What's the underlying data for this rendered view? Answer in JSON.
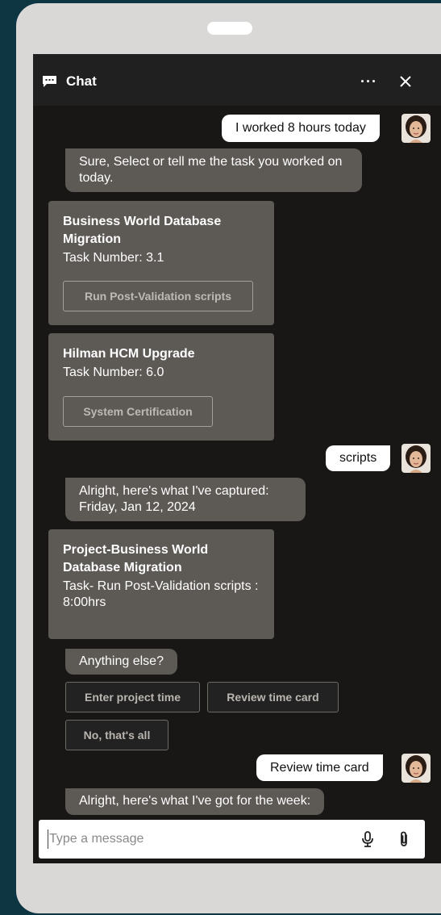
{
  "header": {
    "title": "Chat",
    "chat_icon": "chat-bubble-icon",
    "more_icon": "more-horizontal-icon",
    "close_icon": "close-icon",
    "more_glyph": "···"
  },
  "messages": {
    "m1": "I worked 8 hours today",
    "m2": "Sure, Select or tell me the task you worked on today.",
    "card1": {
      "title": "Business World Database Migration",
      "subtitle": "Task Number: 3.1",
      "action": "Run Post-Validation scripts"
    },
    "card2": {
      "title": "Hilman HCM Upgrade",
      "subtitle": "Task Number: 6.0",
      "action": "System Certification"
    },
    "m3": "scripts",
    "m4_line1": "Alright, here's what I've captured:",
    "m4_line2": "Friday, Jan 12, 2024",
    "card3": {
      "title": "Project-Business World Database Migration",
      "subtitle": "Task- Run Post-Validation scripts : 8:00hrs"
    },
    "m5": "Anything else?",
    "chips": {
      "enter": "Enter project time",
      "review": "Review time card",
      "none": "No, that's all"
    },
    "m6": "Review time card",
    "m7": "Alright, here's what I've got for the week:"
  },
  "composer": {
    "placeholder": "Type a message",
    "mic_icon": "microphone-icon",
    "attach_icon": "paperclip-icon"
  },
  "colors": {
    "background": "#0d3542",
    "phone": "#d9d8d6",
    "screen": "#181716",
    "bot_bubble": "#5d5955",
    "user_bubble": "#ffffff"
  }
}
